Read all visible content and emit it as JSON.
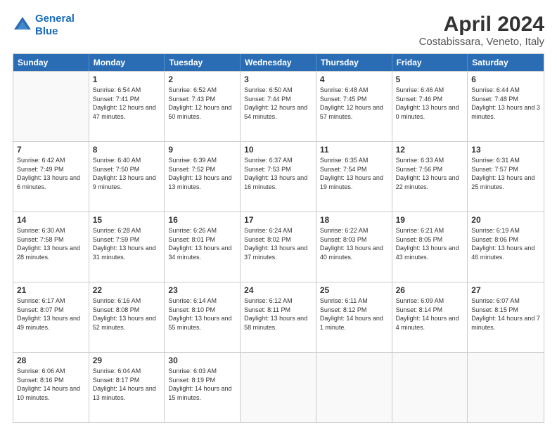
{
  "header": {
    "logo_line1": "General",
    "logo_line2": "Blue",
    "title": "April 2024",
    "subtitle": "Costabissara, Veneto, Italy"
  },
  "days_of_week": [
    "Sunday",
    "Monday",
    "Tuesday",
    "Wednesday",
    "Thursday",
    "Friday",
    "Saturday"
  ],
  "weeks": [
    [
      {
        "day": "",
        "empty": true
      },
      {
        "day": "1",
        "sunrise": "Sunrise: 6:54 AM",
        "sunset": "Sunset: 7:41 PM",
        "daylight": "Daylight: 12 hours and 47 minutes."
      },
      {
        "day": "2",
        "sunrise": "Sunrise: 6:52 AM",
        "sunset": "Sunset: 7:43 PM",
        "daylight": "Daylight: 12 hours and 50 minutes."
      },
      {
        "day": "3",
        "sunrise": "Sunrise: 6:50 AM",
        "sunset": "Sunset: 7:44 PM",
        "daylight": "Daylight: 12 hours and 54 minutes."
      },
      {
        "day": "4",
        "sunrise": "Sunrise: 6:48 AM",
        "sunset": "Sunset: 7:45 PM",
        "daylight": "Daylight: 12 hours and 57 minutes."
      },
      {
        "day": "5",
        "sunrise": "Sunrise: 6:46 AM",
        "sunset": "Sunset: 7:46 PM",
        "daylight": "Daylight: 13 hours and 0 minutes."
      },
      {
        "day": "6",
        "sunrise": "Sunrise: 6:44 AM",
        "sunset": "Sunset: 7:48 PM",
        "daylight": "Daylight: 13 hours and 3 minutes."
      }
    ],
    [
      {
        "day": "7",
        "sunrise": "Sunrise: 6:42 AM",
        "sunset": "Sunset: 7:49 PM",
        "daylight": "Daylight: 13 hours and 6 minutes."
      },
      {
        "day": "8",
        "sunrise": "Sunrise: 6:40 AM",
        "sunset": "Sunset: 7:50 PM",
        "daylight": "Daylight: 13 hours and 9 minutes."
      },
      {
        "day": "9",
        "sunrise": "Sunrise: 6:39 AM",
        "sunset": "Sunset: 7:52 PM",
        "daylight": "Daylight: 13 hours and 13 minutes."
      },
      {
        "day": "10",
        "sunrise": "Sunrise: 6:37 AM",
        "sunset": "Sunset: 7:53 PM",
        "daylight": "Daylight: 13 hours and 16 minutes."
      },
      {
        "day": "11",
        "sunrise": "Sunrise: 6:35 AM",
        "sunset": "Sunset: 7:54 PM",
        "daylight": "Daylight: 13 hours and 19 minutes."
      },
      {
        "day": "12",
        "sunrise": "Sunrise: 6:33 AM",
        "sunset": "Sunset: 7:56 PM",
        "daylight": "Daylight: 13 hours and 22 minutes."
      },
      {
        "day": "13",
        "sunrise": "Sunrise: 6:31 AM",
        "sunset": "Sunset: 7:57 PM",
        "daylight": "Daylight: 13 hours and 25 minutes."
      }
    ],
    [
      {
        "day": "14",
        "sunrise": "Sunrise: 6:30 AM",
        "sunset": "Sunset: 7:58 PM",
        "daylight": "Daylight: 13 hours and 28 minutes."
      },
      {
        "day": "15",
        "sunrise": "Sunrise: 6:28 AM",
        "sunset": "Sunset: 7:59 PM",
        "daylight": "Daylight: 13 hours and 31 minutes."
      },
      {
        "day": "16",
        "sunrise": "Sunrise: 6:26 AM",
        "sunset": "Sunset: 8:01 PM",
        "daylight": "Daylight: 13 hours and 34 minutes."
      },
      {
        "day": "17",
        "sunrise": "Sunrise: 6:24 AM",
        "sunset": "Sunset: 8:02 PM",
        "daylight": "Daylight: 13 hours and 37 minutes."
      },
      {
        "day": "18",
        "sunrise": "Sunrise: 6:22 AM",
        "sunset": "Sunset: 8:03 PM",
        "daylight": "Daylight: 13 hours and 40 minutes."
      },
      {
        "day": "19",
        "sunrise": "Sunrise: 6:21 AM",
        "sunset": "Sunset: 8:05 PM",
        "daylight": "Daylight: 13 hours and 43 minutes."
      },
      {
        "day": "20",
        "sunrise": "Sunrise: 6:19 AM",
        "sunset": "Sunset: 8:06 PM",
        "daylight": "Daylight: 13 hours and 46 minutes."
      }
    ],
    [
      {
        "day": "21",
        "sunrise": "Sunrise: 6:17 AM",
        "sunset": "Sunset: 8:07 PM",
        "daylight": "Daylight: 13 hours and 49 minutes."
      },
      {
        "day": "22",
        "sunrise": "Sunrise: 6:16 AM",
        "sunset": "Sunset: 8:08 PM",
        "daylight": "Daylight: 13 hours and 52 minutes."
      },
      {
        "day": "23",
        "sunrise": "Sunrise: 6:14 AM",
        "sunset": "Sunset: 8:10 PM",
        "daylight": "Daylight: 13 hours and 55 minutes."
      },
      {
        "day": "24",
        "sunrise": "Sunrise: 6:12 AM",
        "sunset": "Sunset: 8:11 PM",
        "daylight": "Daylight: 13 hours and 58 minutes."
      },
      {
        "day": "25",
        "sunrise": "Sunrise: 6:11 AM",
        "sunset": "Sunset: 8:12 PM",
        "daylight": "Daylight: 14 hours and 1 minute."
      },
      {
        "day": "26",
        "sunrise": "Sunrise: 6:09 AM",
        "sunset": "Sunset: 8:14 PM",
        "daylight": "Daylight: 14 hours and 4 minutes."
      },
      {
        "day": "27",
        "sunrise": "Sunrise: 6:07 AM",
        "sunset": "Sunset: 8:15 PM",
        "daylight": "Daylight: 14 hours and 7 minutes."
      }
    ],
    [
      {
        "day": "28",
        "sunrise": "Sunrise: 6:06 AM",
        "sunset": "Sunset: 8:16 PM",
        "daylight": "Daylight: 14 hours and 10 minutes."
      },
      {
        "day": "29",
        "sunrise": "Sunrise: 6:04 AM",
        "sunset": "Sunset: 8:17 PM",
        "daylight": "Daylight: 14 hours and 13 minutes."
      },
      {
        "day": "30",
        "sunrise": "Sunrise: 6:03 AM",
        "sunset": "Sunset: 8:19 PM",
        "daylight": "Daylight: 14 hours and 15 minutes."
      },
      {
        "day": "",
        "empty": true
      },
      {
        "day": "",
        "empty": true
      },
      {
        "day": "",
        "empty": true
      },
      {
        "day": "",
        "empty": true
      }
    ]
  ]
}
